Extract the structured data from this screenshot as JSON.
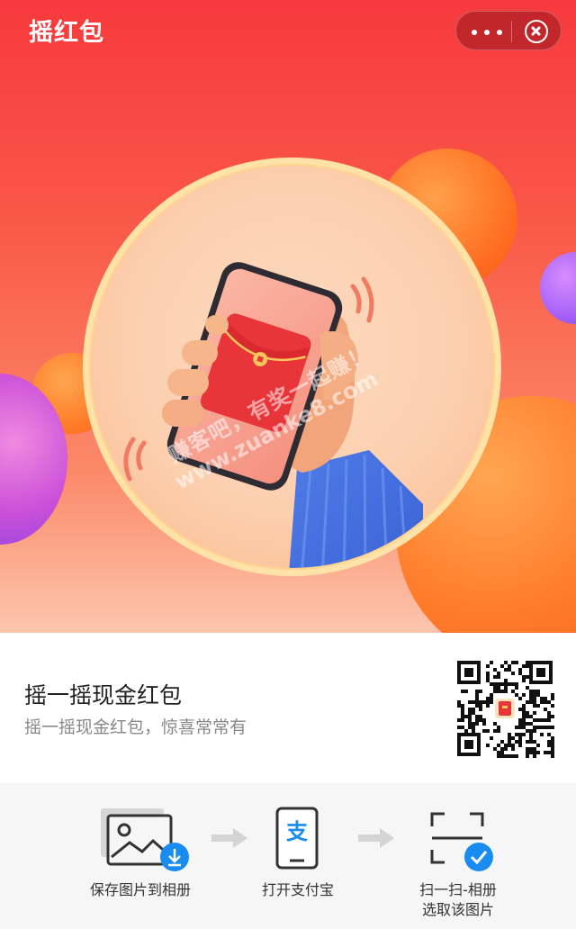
{
  "header": {
    "title": "摇红包",
    "more_icon": "more-dots-icon",
    "close_icon": "close-circle-icon"
  },
  "hero": {
    "illustration": "phone-shaking-red-packet",
    "watermark_line1": "赚客吧，有奖一起赚！",
    "watermark_line2": "www.zuanke8.com"
  },
  "card": {
    "title": "摇一摇现金红包",
    "subtitle": "摇一摇现金红包，惊喜常常有",
    "qr_icon": "qr-code-icon"
  },
  "steps": [
    {
      "label": "保存图片到相册",
      "icon": "save-image-icon"
    },
    {
      "label": "打开支付宝",
      "icon": "alipay-phone-icon"
    },
    {
      "label_line1": "扫一扫-相册",
      "label_line2": "选取该图片",
      "icon": "scan-icon"
    }
  ],
  "colors": {
    "header_red": "#f7393d",
    "accent_blue": "#1a8cf0",
    "packet_red": "#e8353a"
  }
}
